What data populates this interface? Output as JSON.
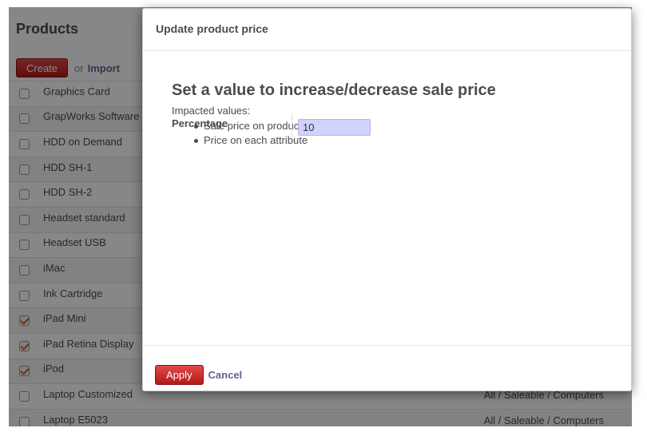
{
  "app": {
    "title": "Products",
    "create_label": "Create",
    "or_label": "or",
    "import_label": "Import"
  },
  "rows": [
    {
      "name": "Graphics Card",
      "checked": false,
      "category": ""
    },
    {
      "name": "GrapWorks Software",
      "checked": false,
      "category": ""
    },
    {
      "name": "HDD on Demand",
      "checked": false,
      "category": ""
    },
    {
      "name": "HDD SH-1",
      "checked": false,
      "category": ""
    },
    {
      "name": "HDD SH-2",
      "checked": false,
      "category": ""
    },
    {
      "name": "Headset standard",
      "checked": false,
      "category": ""
    },
    {
      "name": "Headset USB",
      "checked": false,
      "category": ""
    },
    {
      "name": "iMac",
      "checked": false,
      "category": ""
    },
    {
      "name": "Ink Cartridge",
      "checked": false,
      "category": ""
    },
    {
      "name": "iPad Mini",
      "checked": true,
      "category": ""
    },
    {
      "name": "iPad Retina Display",
      "checked": true,
      "category": ""
    },
    {
      "name": "iPod",
      "checked": true,
      "category": ""
    },
    {
      "name": "Laptop Customized",
      "checked": false,
      "category": "All / Saleable / Computers"
    },
    {
      "name": "Laptop E5023",
      "checked": false,
      "category": "All / Saleable / Computers"
    }
  ],
  "modal": {
    "title": "Update product price",
    "heading": "Set a value to increase/decrease sale price",
    "impacted_label": "Impacted values:",
    "impacted_items": [
      "Sale price on product",
      "Price on each attribute"
    ],
    "field_label": "Percentage",
    "field_value": "10",
    "apply_label": "Apply",
    "cancel_label": "Cancel"
  },
  "colors": {
    "primary_button": "#c42a2a",
    "link": "#6c5d96",
    "input_required_bg": "#d2d2ff"
  }
}
